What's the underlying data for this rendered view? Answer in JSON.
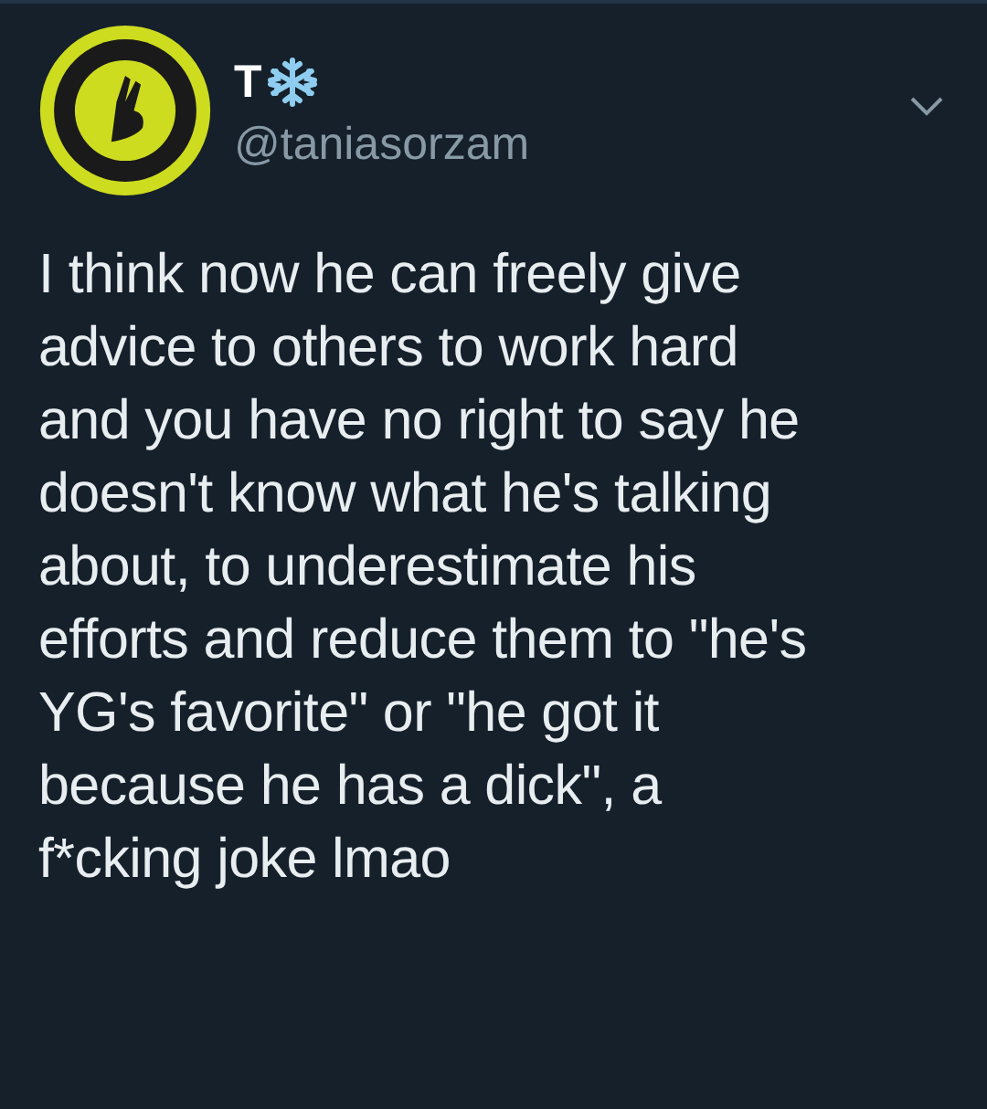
{
  "tweet": {
    "display_name": "T",
    "handle": "@taniasorzam",
    "text": "I think now he can freely give\nadvice to others to work hard\nand you have no right to say he\ndoesn't know what he's talking\nabout, to underestimate his\nefforts and reduce them to \"he's\nYG's favorite\" or \"he got it\nbecause he has a dick\", a\nf*cking joke lmao"
  }
}
